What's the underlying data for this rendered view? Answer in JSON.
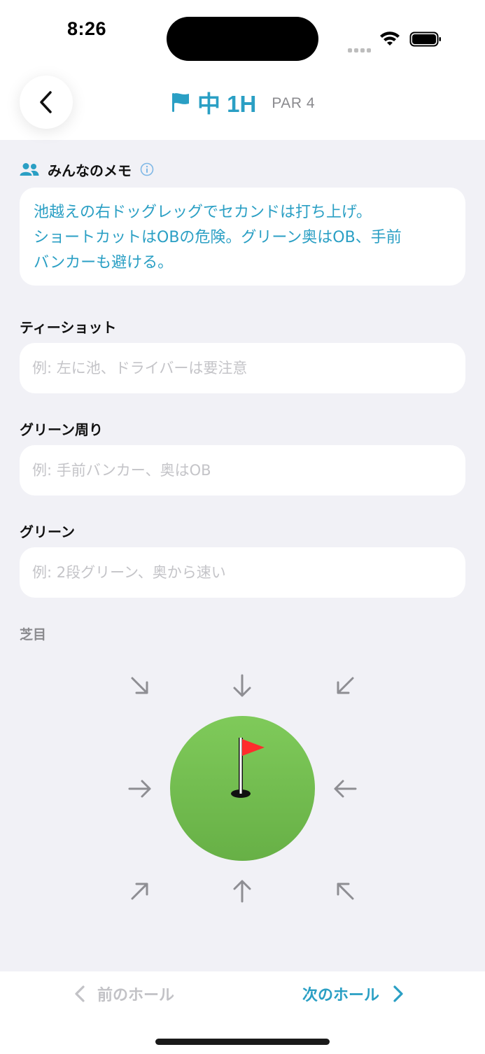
{
  "status": {
    "time": "8:26"
  },
  "header": {
    "title": "中 1H",
    "par": "PAR 4"
  },
  "memo": {
    "label": "みんなのメモ",
    "lines": [
      "池越えの右ドッグレッグでセカンドは打ち上げ。",
      "ショートカットはOBの危険。グリーン奥はOB、手前",
      "バンカーも避ける。"
    ]
  },
  "tee_shot": {
    "label": "ティーショット",
    "placeholder": "例: 左に池、ドライバーは要注意"
  },
  "around_green": {
    "label": "グリーン周り",
    "placeholder": "例: 手前バンカー、奥はOB"
  },
  "green": {
    "label": "グリーン",
    "placeholder": "例: 2段グリーン、奥から速い"
  },
  "lawn": {
    "label": "芝目"
  },
  "nav": {
    "prev_label": "前のホール",
    "next_label": "次のホール"
  },
  "colors": {
    "accent": "#2a9fc4",
    "green": "#72bd50",
    "flag": "#ff2d2d"
  },
  "icons": [
    "flag-icon",
    "people-icon",
    "info-icon",
    "arrow-icon",
    "pin-icon",
    "chevron-left-icon",
    "chevron-right-icon"
  ]
}
